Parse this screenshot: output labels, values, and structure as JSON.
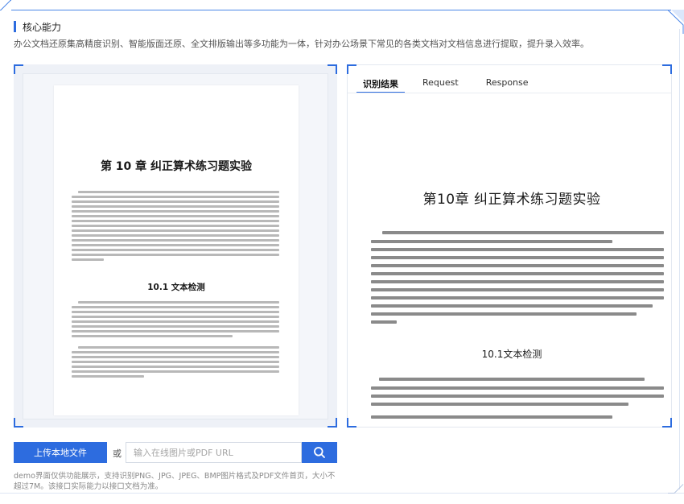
{
  "section": {
    "title": "核心能力",
    "description": "办公文档还原集高精度识别、智能版面还原、全文排版输出等多功能为一体，针对办公场景下常见的各类文档对文档信息进行提取，提升录入效率。"
  },
  "document_preview": {
    "chapter_title": "第 10 章    纠正算术练习题实验",
    "section_title": "10.1    文本检测"
  },
  "result_panel": {
    "tabs": [
      {
        "label": "识别结果",
        "active": true
      },
      {
        "label": "Request",
        "active": false
      },
      {
        "label": "Response",
        "active": false
      }
    ],
    "chapter_title": "第10章    纠正算术练习题实验",
    "section_title": "10.1文本检测"
  },
  "controls": {
    "upload_label": "上传本地文件",
    "or_label": "或",
    "url_placeholder": "输入在线图片或PDF URL",
    "search_icon": "search-icon"
  },
  "note": "demo界面仅供功能展示，支持识别PNG、JPG、JPEG、BMP图片格式及PDF文件首页，大小不超过7M。该接口实际能力以接口文档为准。",
  "colors": {
    "accent": "#2d6cdf",
    "frame": "#4a86e8"
  }
}
